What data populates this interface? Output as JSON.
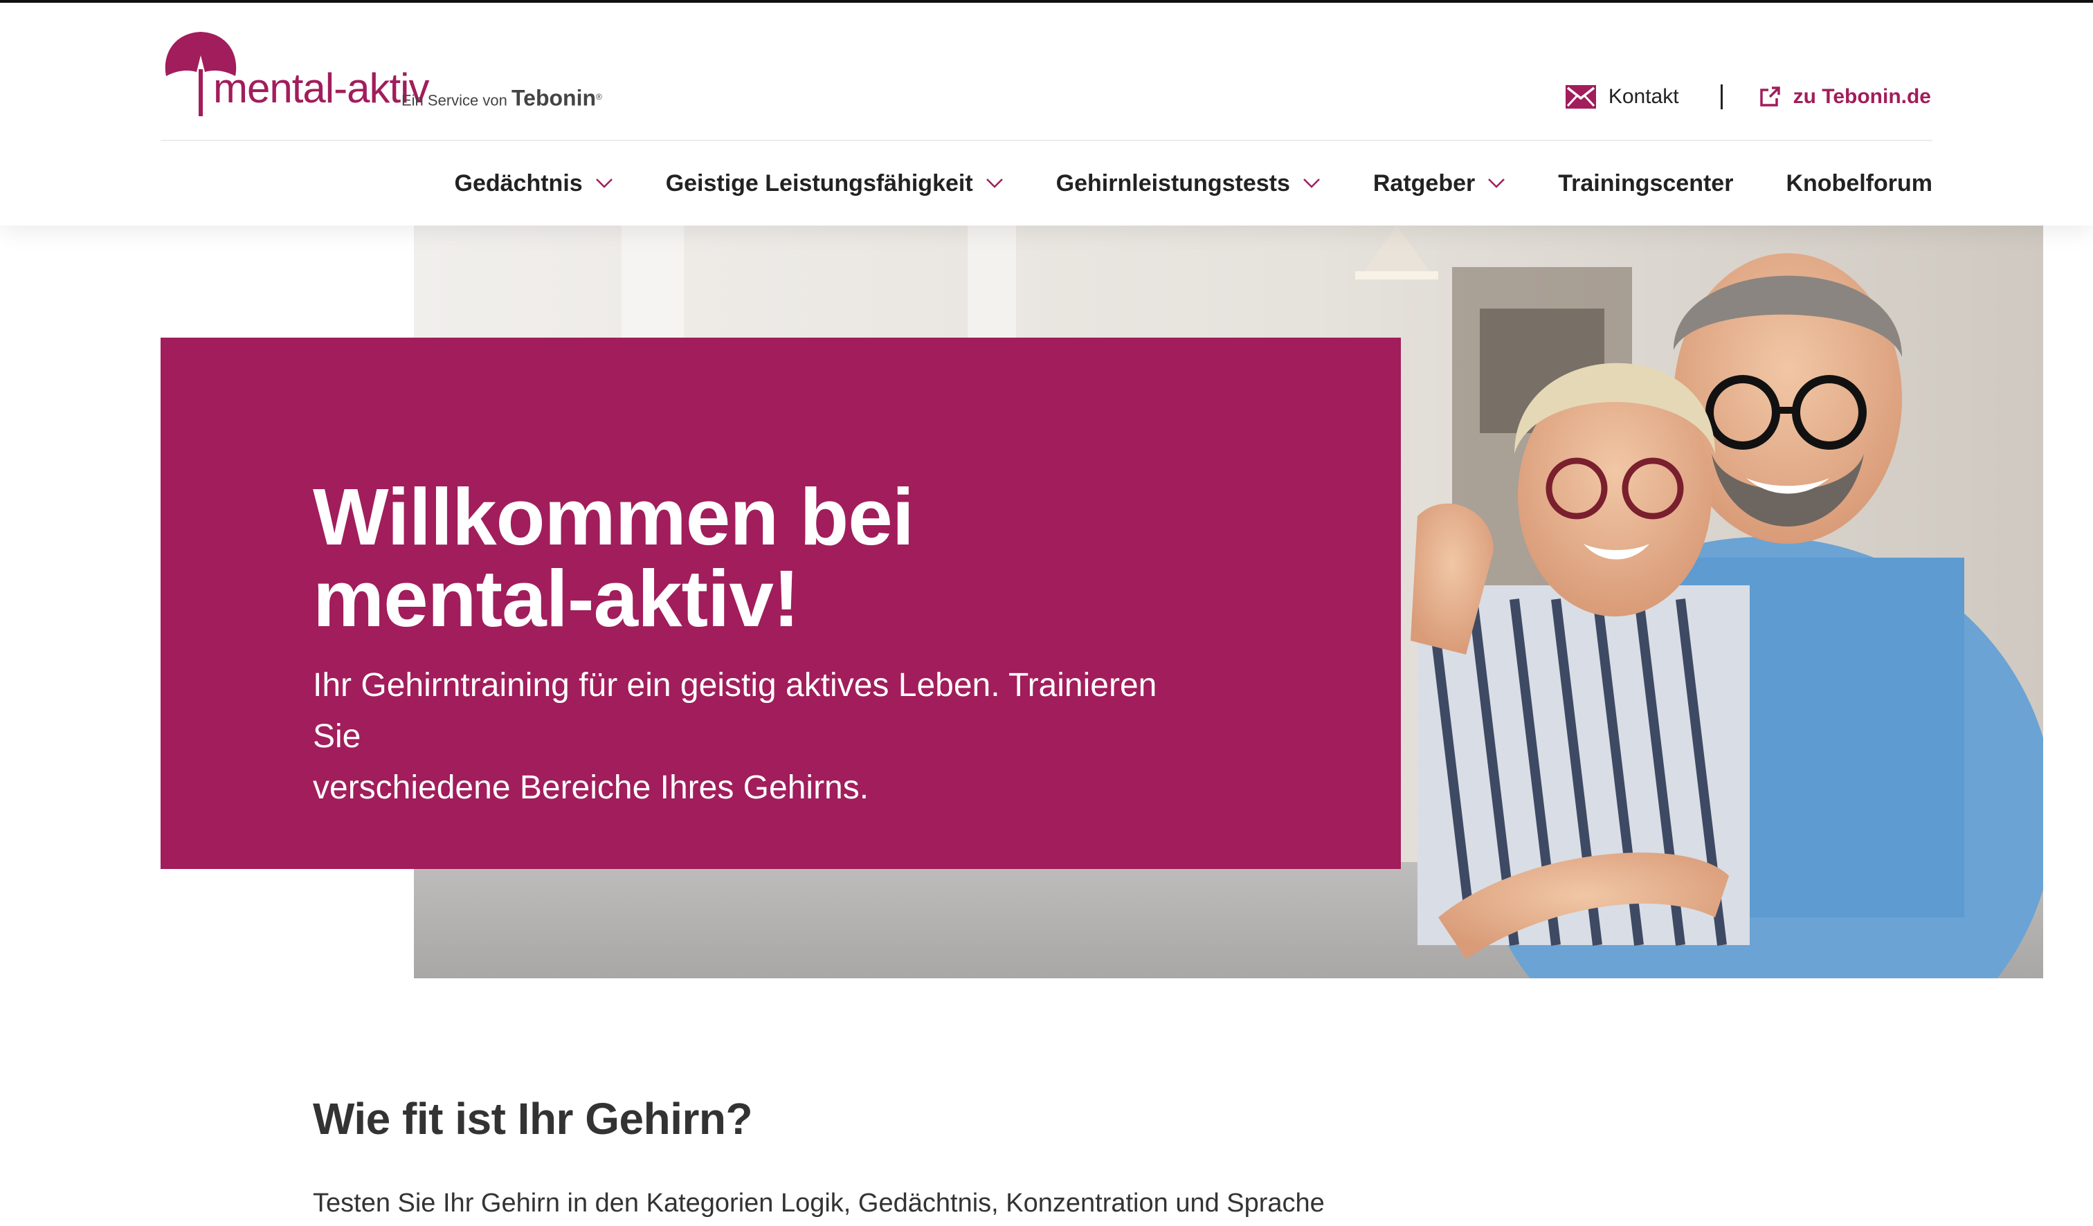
{
  "colors": {
    "brand": "#a11d5b",
    "text": "#222222",
    "heading": "#333333"
  },
  "logo": {
    "brand_text": "mental-aktiv",
    "service_text": "Ein Service von",
    "tebonin": "Tebonin",
    "registered": "®",
    "icon": "ginkgo-leaf-icon"
  },
  "util_nav": {
    "contact_label": "Kontakt",
    "contact_icon": "mail-icon",
    "separator": "|",
    "external_label": "zu Tebonin.de",
    "external_icon": "external-link-icon"
  },
  "main_nav": {
    "items": [
      {
        "label": "Gedächtnis",
        "has_dropdown": true
      },
      {
        "label": "Geistige Leistungsfähigkeit",
        "has_dropdown": true
      },
      {
        "label": "Gehirnleistungstests",
        "has_dropdown": true
      },
      {
        "label": "Ratgeber",
        "has_dropdown": true
      },
      {
        "label": "Trainingscenter",
        "has_dropdown": false
      },
      {
        "label": "Knobelforum",
        "has_dropdown": false
      }
    ]
  },
  "hero": {
    "title_line1": "Willkommen bei",
    "title_line2": "mental-aktiv!",
    "subtitle_line1": "Ihr Gehirntraining für ein geistig aktives Leben. Trainieren Sie",
    "subtitle_line2": "verschiedene Bereiche Ihres Gehirns."
  },
  "section": {
    "title": "Wie fit ist Ihr Gehirn?",
    "text": "Testen Sie Ihr Gehirn in den Kategorien Logik, Gedächtnis, Konzentration und Sprache"
  }
}
